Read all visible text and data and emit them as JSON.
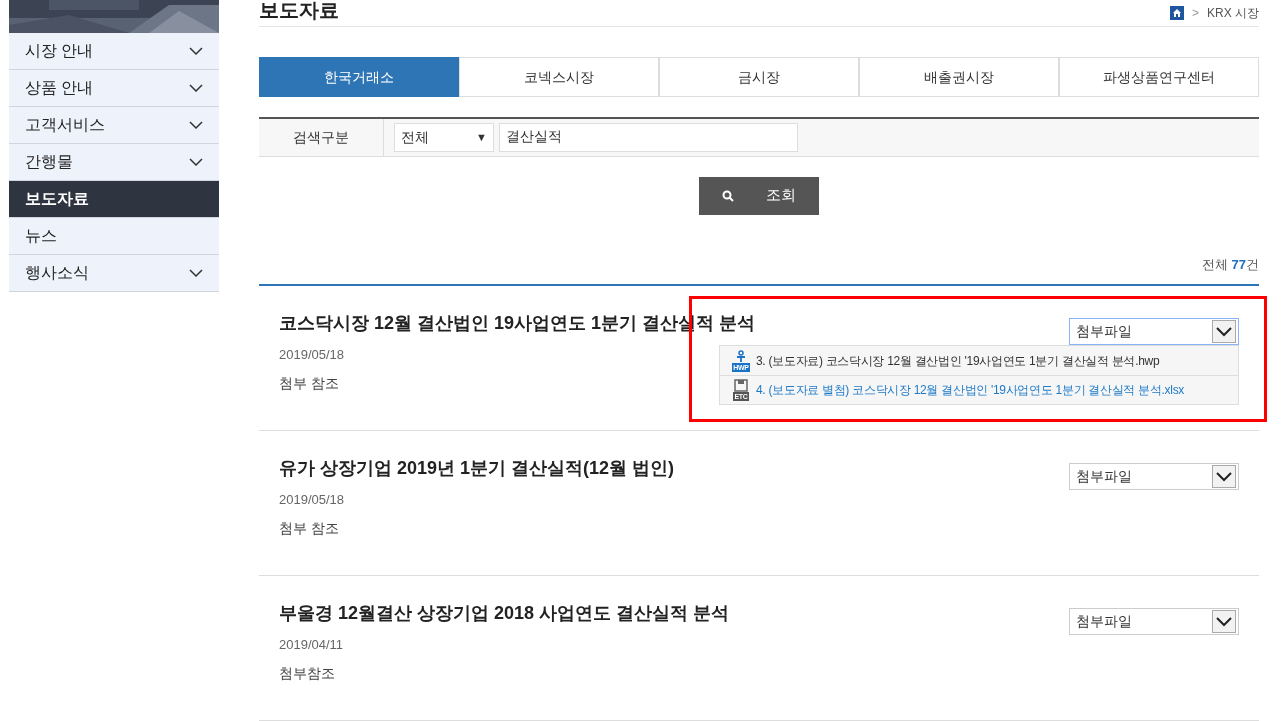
{
  "sidebar": {
    "items": [
      {
        "label": "시장 안내",
        "selected": false,
        "expandable": true
      },
      {
        "label": "상품 안내",
        "selected": false,
        "expandable": true
      },
      {
        "label": "고객서비스",
        "selected": false,
        "expandable": true
      },
      {
        "label": "간행물",
        "selected": false,
        "expandable": true
      },
      {
        "label": "보도자료",
        "selected": true,
        "expandable": false
      },
      {
        "label": "뉴스",
        "selected": false,
        "expandable": false
      },
      {
        "label": "행사소식",
        "selected": false,
        "expandable": true
      }
    ]
  },
  "page_title": "보도자료",
  "breadcrumb": {
    "separator": ">",
    "current": "KRX 시장"
  },
  "tabs": [
    {
      "label": "한국거래소",
      "selected": true
    },
    {
      "label": "코넥스시장",
      "selected": false
    },
    {
      "label": "금시장",
      "selected": false
    },
    {
      "label": "배출권시장",
      "selected": false
    },
    {
      "label": "파생상품연구센터",
      "selected": false
    }
  ],
  "search": {
    "label": "검색구분",
    "category": "전체",
    "category_arrow": "▼",
    "query": "결산실적",
    "button": "조회"
  },
  "total": {
    "prefix": "전체",
    "count": "77",
    "suffix": "건"
  },
  "articles": [
    {
      "title": "코스닥시장 12월 결산법인 19사업연도 1분기 결산실적 분석",
      "date": "2019/05/18",
      "note": "첨부 참조",
      "attachment": "첨부파일",
      "expanded": true,
      "highlighted": true,
      "files": [
        {
          "kind": "hwp",
          "icon_label": "HWP",
          "name": "3. (보도자료) 코스닥시장 12월 결산법인 '19사업연도 1분기 결산실적 분석.hwp",
          "selected": false
        },
        {
          "kind": "etc",
          "icon_label": "ETC",
          "name": "4. (보도자료 별첨) 코스닥시장 12월 결산법인 '19사업연도 1분기 결산실적 분석.xlsx",
          "selected": true
        }
      ]
    },
    {
      "title": "유가 상장기업 2019년 1분기 결산실적(12월 법인)",
      "date": "2019/05/18",
      "note": "첨부 참조",
      "attachment": "첨부파일",
      "expanded": false,
      "highlighted": false
    },
    {
      "title": "부울경 12월결산 상장기업 2018 사업연도 결산실적 분석",
      "date": "2019/04/11",
      "note": "첨부참조",
      "attachment": "첨부파일",
      "expanded": false,
      "highlighted": false
    }
  ]
}
